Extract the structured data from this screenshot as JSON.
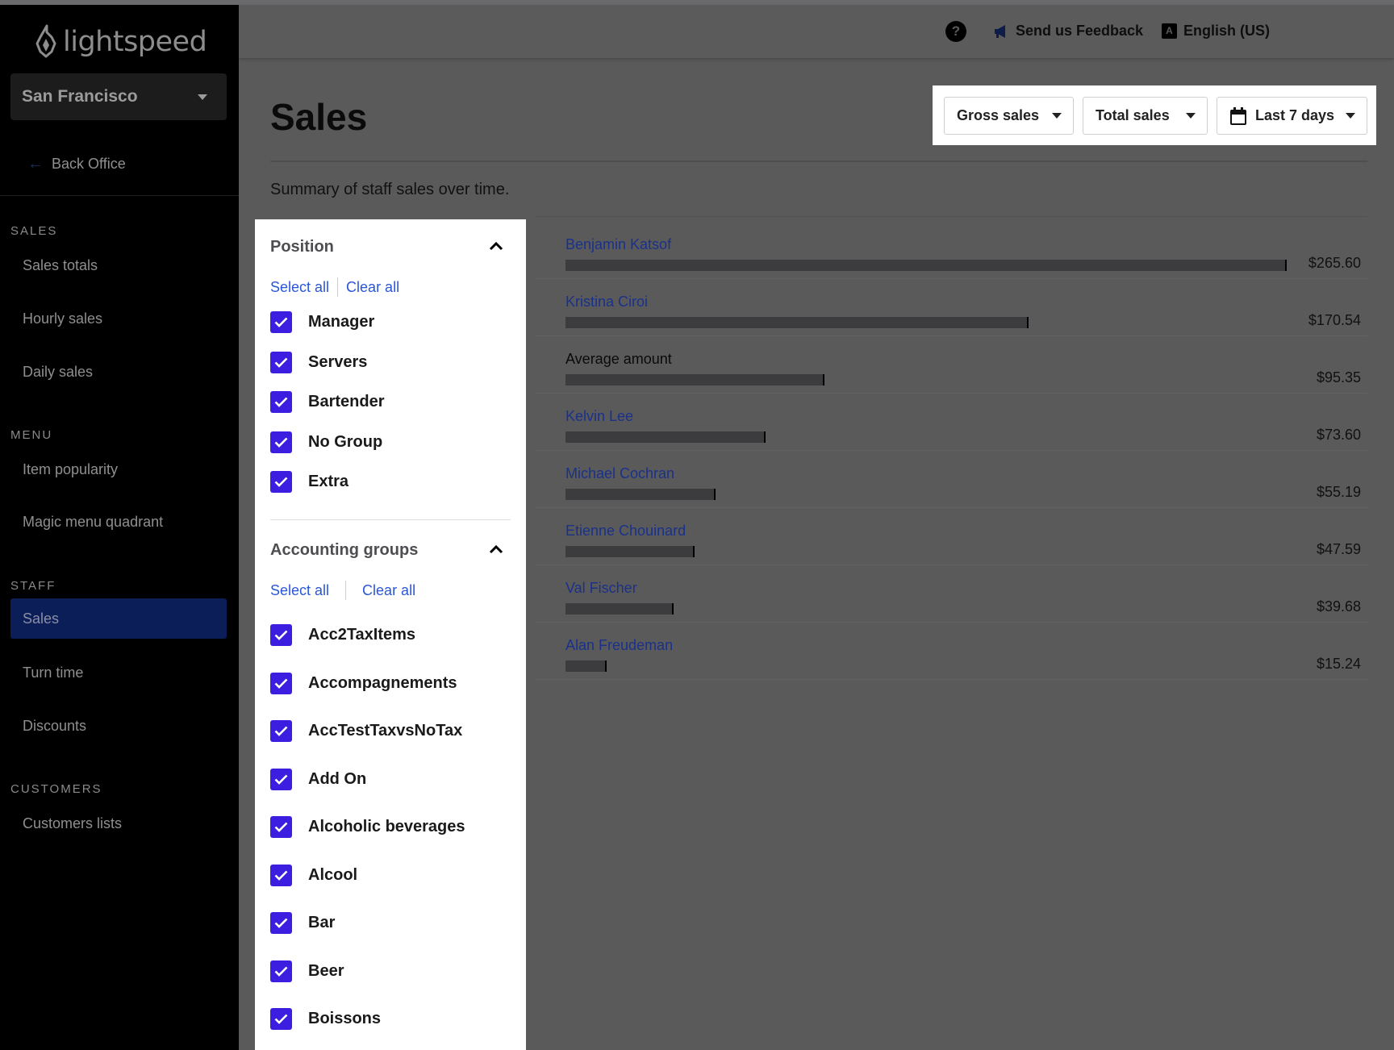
{
  "brand": {
    "name": "lightspeed"
  },
  "location": {
    "name": "San Francisco"
  },
  "back_office": "Back Office",
  "sidebar": {
    "sections": [
      {
        "title": "SALES",
        "items": [
          "Sales totals",
          "Hourly sales",
          "Daily sales"
        ]
      },
      {
        "title": "MENU",
        "items": [
          "Item popularity",
          "Magic menu quadrant"
        ]
      },
      {
        "title": "STAFF",
        "items": [
          "Sales",
          "Turn time",
          "Discounts"
        ]
      },
      {
        "title": "CUSTOMERS",
        "items": [
          "Customers lists"
        ]
      }
    ],
    "active_item": "Sales"
  },
  "header": {
    "help": "?",
    "feedback": "Send us Feedback",
    "language_icon_letter": "A",
    "language": "English (US)"
  },
  "page": {
    "title": "Sales",
    "subtitle": "Summary of staff sales over time."
  },
  "controls": {
    "metric": "Gross sales",
    "measure": "Total sales",
    "range": "Last 7 days"
  },
  "filters": {
    "position": {
      "title": "Position",
      "select_all": "Select all",
      "clear_all": "Clear all",
      "options": [
        "Manager",
        "Servers",
        "Bartender",
        "No Group",
        "Extra"
      ]
    },
    "accounting": {
      "title": "Accounting groups",
      "select_all": "Select all",
      "clear_all": "Clear all",
      "options": [
        "Acc2TaxItems",
        "Accompagnements",
        "AccTestTaxvsNoTax",
        "Add On",
        "Alcoholic beverages",
        "Alcool",
        "Bar",
        "Beer",
        "Boissons"
      ]
    }
  },
  "chart_data": {
    "type": "bar",
    "orientation": "horizontal",
    "max": 265.6,
    "rows": [
      {
        "name": "Benjamin Katsof",
        "value": 265.6,
        "label": "$265.60",
        "link": true
      },
      {
        "name": "Kristina Ciroi",
        "value": 170.54,
        "label": "$170.54",
        "link": true
      },
      {
        "name": "Average amount",
        "value": 95.35,
        "label": "$95.35",
        "link": false
      },
      {
        "name": "Kelvin Lee",
        "value": 73.6,
        "label": "$73.60",
        "link": true
      },
      {
        "name": "Michael Cochran",
        "value": 55.19,
        "label": "$55.19",
        "link": true
      },
      {
        "name": "Etienne Chouinard",
        "value": 47.59,
        "label": "$47.59",
        "link": true
      },
      {
        "name": "Val Fischer",
        "value": 39.68,
        "label": "$39.68",
        "link": true
      },
      {
        "name": "Alan Freudeman",
        "value": 15.24,
        "label": "$15.24",
        "link": true
      }
    ]
  },
  "colors": {
    "sidebar_active": "#0c1e57",
    "checkbox": "#3b1ee0",
    "link": "#2a56d8"
  }
}
